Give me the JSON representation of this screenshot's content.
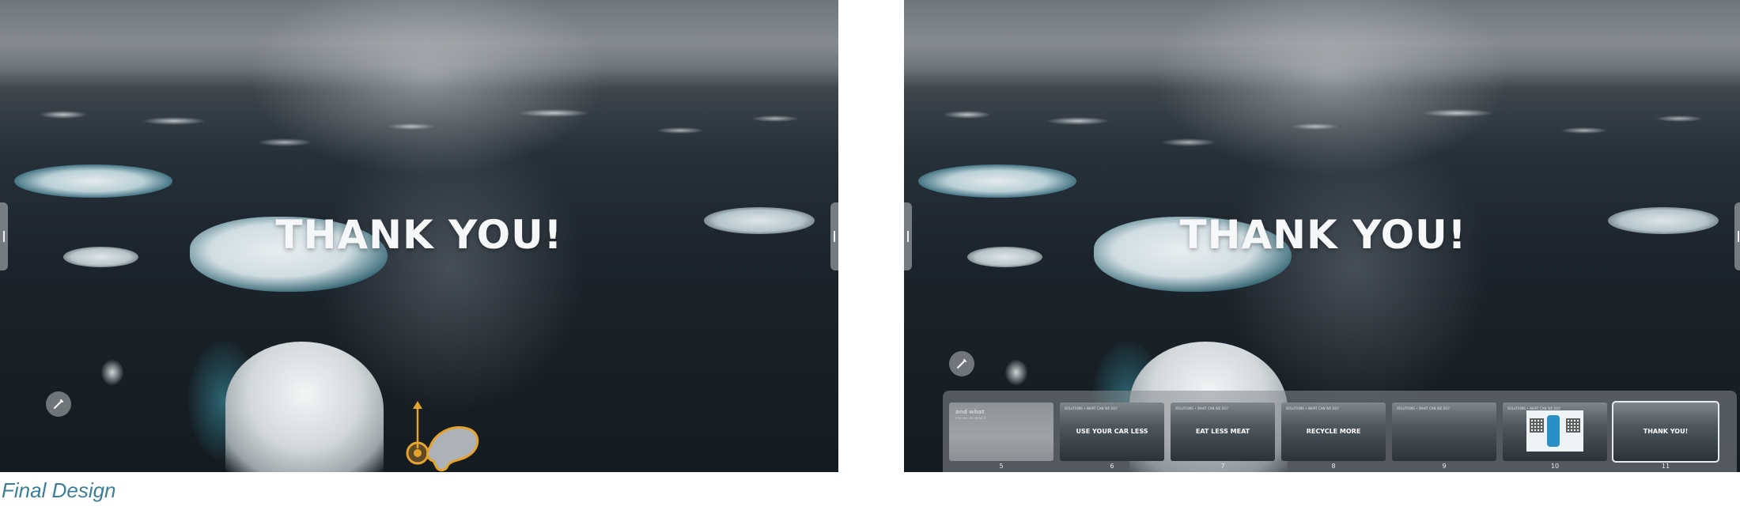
{
  "slide": {
    "title": "THANK YOU!"
  },
  "caption": "Final Design",
  "icons": {
    "pen": "pen-icon",
    "gesture": "tap-swipe-up-gesture-icon",
    "side_tab": "side-handle-icon"
  },
  "colors": {
    "caption": "#3a7f97",
    "gesture": "#e5a32e",
    "filmstrip": "#878c92"
  },
  "filmstrip": {
    "thumbnails": [
      {
        "number": "5",
        "faded_title": "and what",
        "faded_sub": "can you do about it",
        "title": "",
        "header": ""
      },
      {
        "number": "6",
        "header": "SOLUTIONS • WHAT CAN WE DO?",
        "title": "USE YOUR CAR LESS",
        "sub": ""
      },
      {
        "number": "7",
        "header": "SOLUTIONS • WHAT CAN WE DO?",
        "title": "EAT LESS MEAT",
        "sub": ""
      },
      {
        "number": "8",
        "header": "SOLUTIONS • WHAT CAN WE DO?",
        "title": "RECYCLE MORE",
        "sub": ""
      },
      {
        "number": "9",
        "header": "SOLUTIONS • WHAT CAN WE DO?",
        "title": "",
        "sub": ""
      },
      {
        "number": "10",
        "header": "SOLUTIONS • WHAT CAN WE DO?",
        "title": "",
        "sub": ""
      },
      {
        "number": "11",
        "header": "",
        "title": "THANK YOU!",
        "sub": ""
      }
    ],
    "current": "11"
  }
}
